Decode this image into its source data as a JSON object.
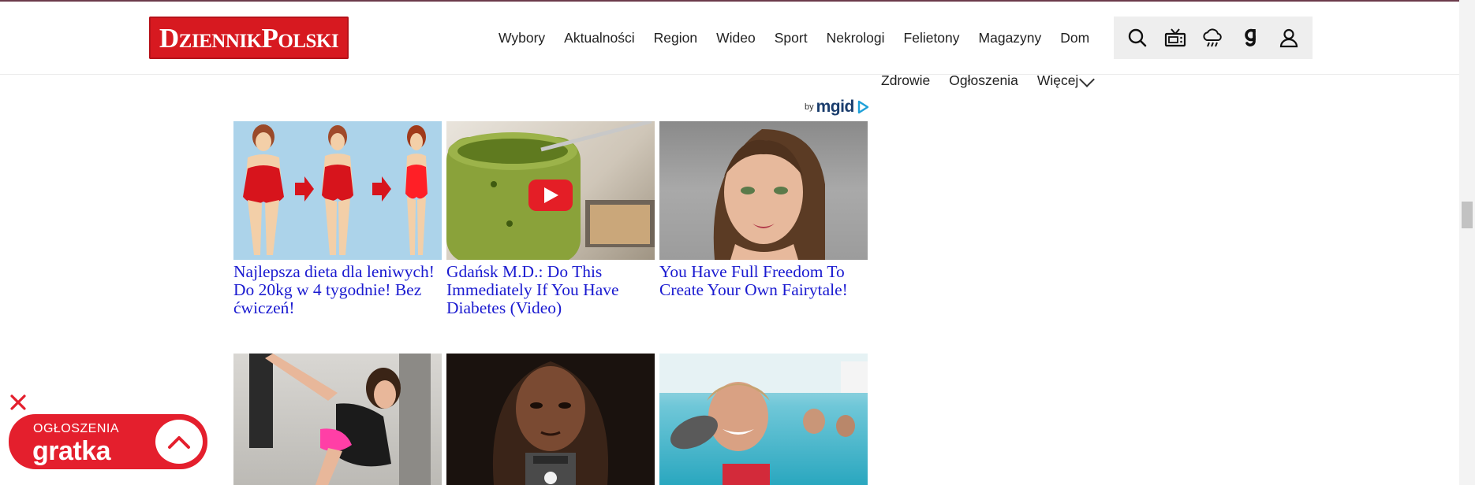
{
  "header": {
    "logo_text": "DziennikPolski",
    "nav_items": [
      "Wybory",
      "Aktualności",
      "Region",
      "Wideo",
      "Sport",
      "Nekrologi",
      "Felietony",
      "Magazyny",
      "Dom"
    ],
    "nav_items_row2": [
      "Zdrowie",
      "Ogłoszenia",
      "Więcej"
    ],
    "icons": [
      "search-icon",
      "tv-icon",
      "weather-icon",
      "gazeta-icon",
      "user-icon"
    ],
    "brand_color": "#d71920"
  },
  "ad_widget": {
    "by_label": "by",
    "provider": "mgid",
    "cards": [
      {
        "title": "Najlepsza dieta dla leniwych! Do 20kg w 4 tygodnie! Bez ćwiczeń!",
        "image": "diet-illustration"
      },
      {
        "title": "Gdańsk M.D.: Do This Immediately If You Have Diabetes (Video)",
        "image": "pesto-jar-video"
      },
      {
        "title": "You Have Full Freedom To Create Your Own Fairytale!",
        "image": "woman-portrait"
      },
      {
        "title": "",
        "image": "kickboxing-woman"
      },
      {
        "title": "",
        "image": "game-character"
      },
      {
        "title": "",
        "image": "swimming-with-seal"
      }
    ],
    "link_color": "#1a1ad0"
  },
  "gratka": {
    "label": "OGŁOSZENIA",
    "brand": "gratka",
    "color": "#e41f2d"
  }
}
